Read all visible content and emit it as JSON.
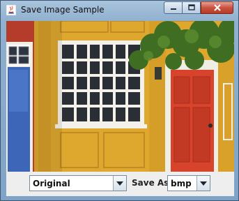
{
  "window": {
    "title": "Save Image Sample",
    "icon": "java-icon",
    "controls": [
      "minimize-icon",
      "maximize-icon",
      "close-icon"
    ]
  },
  "image": {
    "subject": "house facade with windows and red door"
  },
  "controls": {
    "format_select": {
      "selected": "Original",
      "icon": "chevron-down-icon"
    },
    "save_as_label": "Save As",
    "type_select": {
      "selected": "bmp",
      "icon": "chevron-down-icon"
    }
  },
  "colors": {
    "wall": "#e0a92b",
    "door": "#d7432b",
    "blue_wall": "#3e66b8",
    "panel": "#eeeeee"
  }
}
